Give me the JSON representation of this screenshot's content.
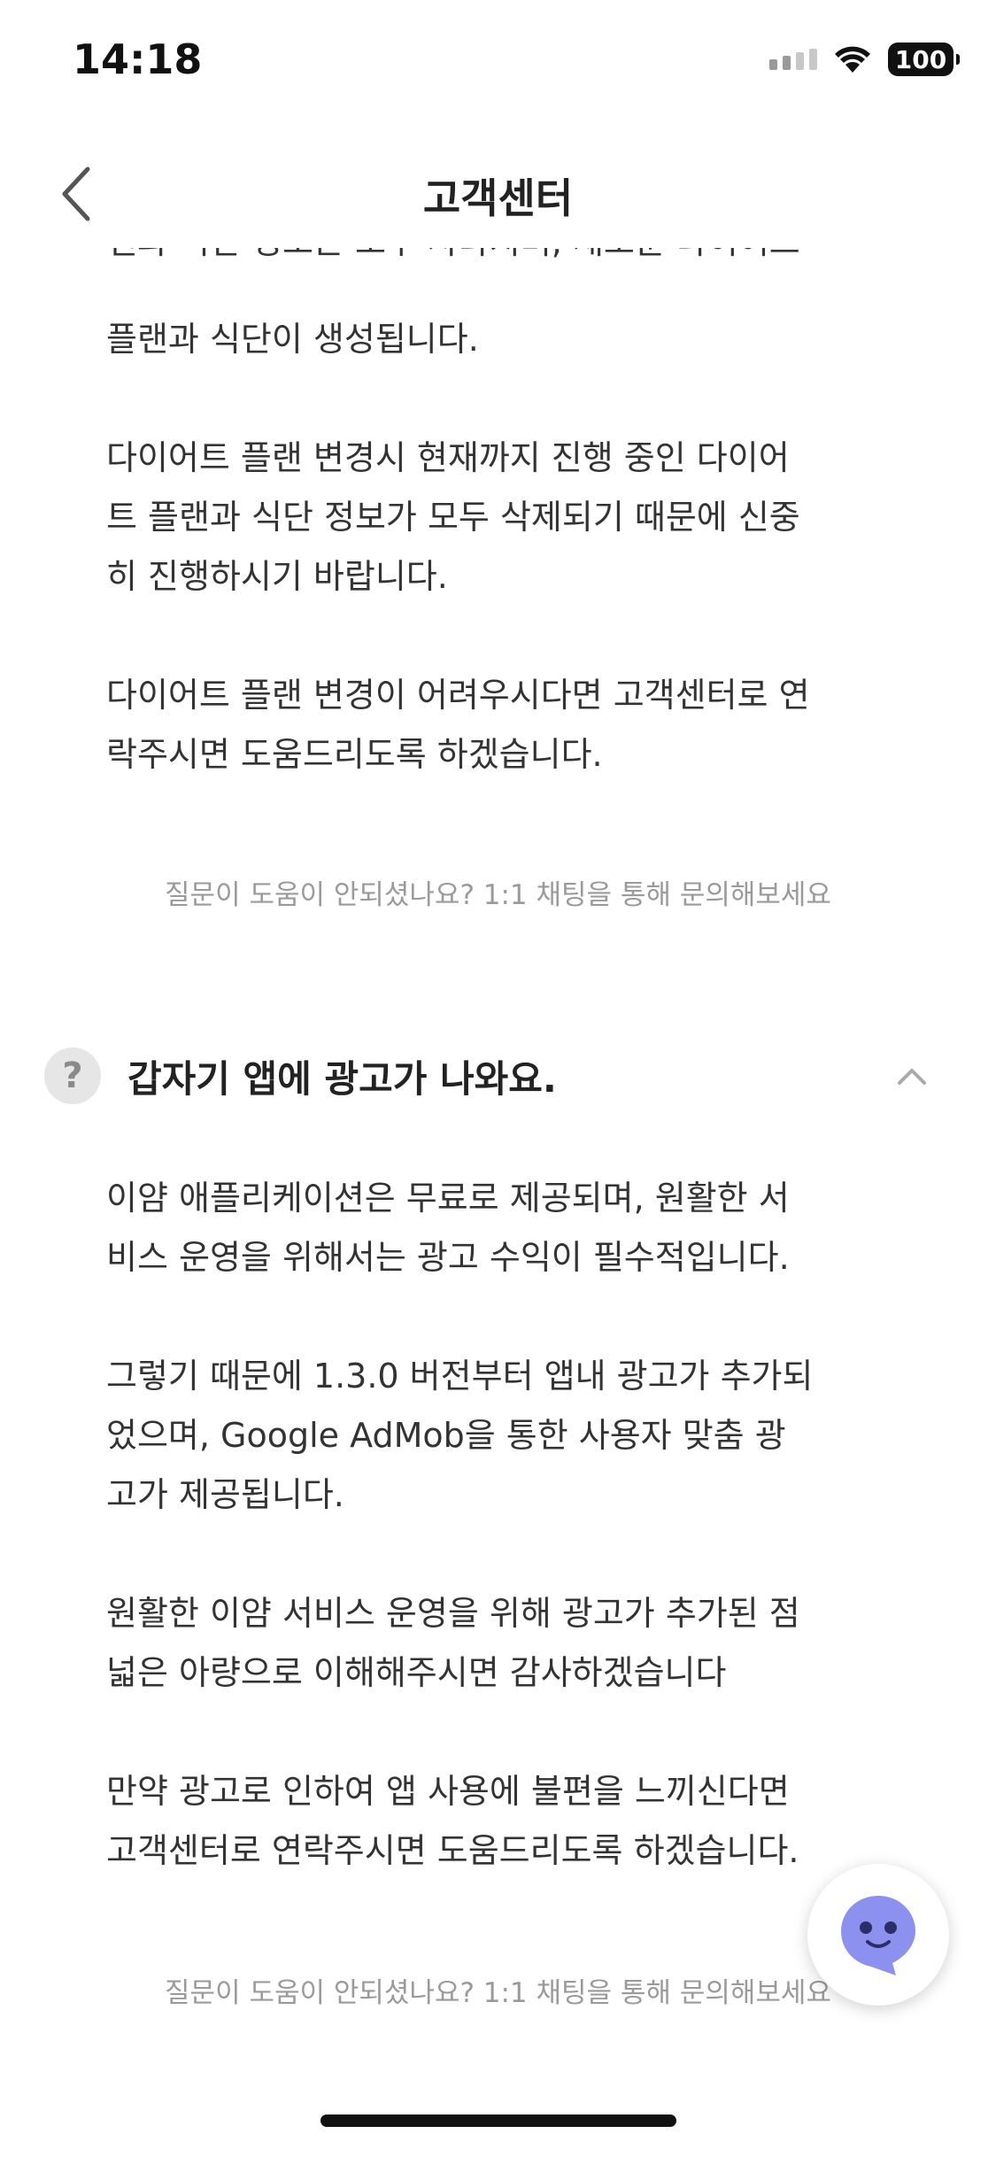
{
  "status_bar": {
    "time": "14:18",
    "battery": "100"
  },
  "nav": {
    "title": "고객센터"
  },
  "first_answer": {
    "clipped_line": "랜과 식단 정보는 모두 사라지며, 새로운 다이어트",
    "paragraphs": [
      "플랜과 식단이 생성됩니다.",
      "다이어트 플랜 변경시 현재까지 진행 중인 다이어\n트 플랜과 식단 정보가 모두 삭제되기 때문에 신중\n히 진행하시기 바랍니다.",
      "다이어트 플랜 변경이 어려우시다면 고객센터로 연\n락주시면 도움드리도록 하겠습니다."
    ],
    "help_note": "질문이 도움이 안되셨나요? 1:1 채팅을 통해 문의해보세요"
  },
  "faq_item": {
    "icon_label": "?",
    "title": "갑자기 앱에 광고가 나와요.",
    "paragraphs": [
      "이얌 애플리케이션은 무료로 제공되며, 원활한 서\n비스 운영을 위해서는 광고 수익이 필수적입니다.",
      "그렇기 때문에 1.3.0 버전부터 앱내 광고가 추가되\n었으며, Google AdMob을 통한 사용자 맞춤 광\n고가 제공됩니다.",
      "원활한 이얌 서비스 운영을 위해 광고가 추가된 점\n넓은 아량으로 이해해주시면 감사하겠습니다",
      "만약 광고로 인하여 앱 사용에 불편을 느끼신다면\n고객센터로 연락주시면 도움드리도록 하겠습니다."
    ],
    "help_note": "질문이 도움이 안되셨나요? 1:1 채팅을 통해 문의해보세요"
  },
  "colors": {
    "accent": "#8c91f0",
    "text": "#333333",
    "muted": "#9a9a9a"
  }
}
